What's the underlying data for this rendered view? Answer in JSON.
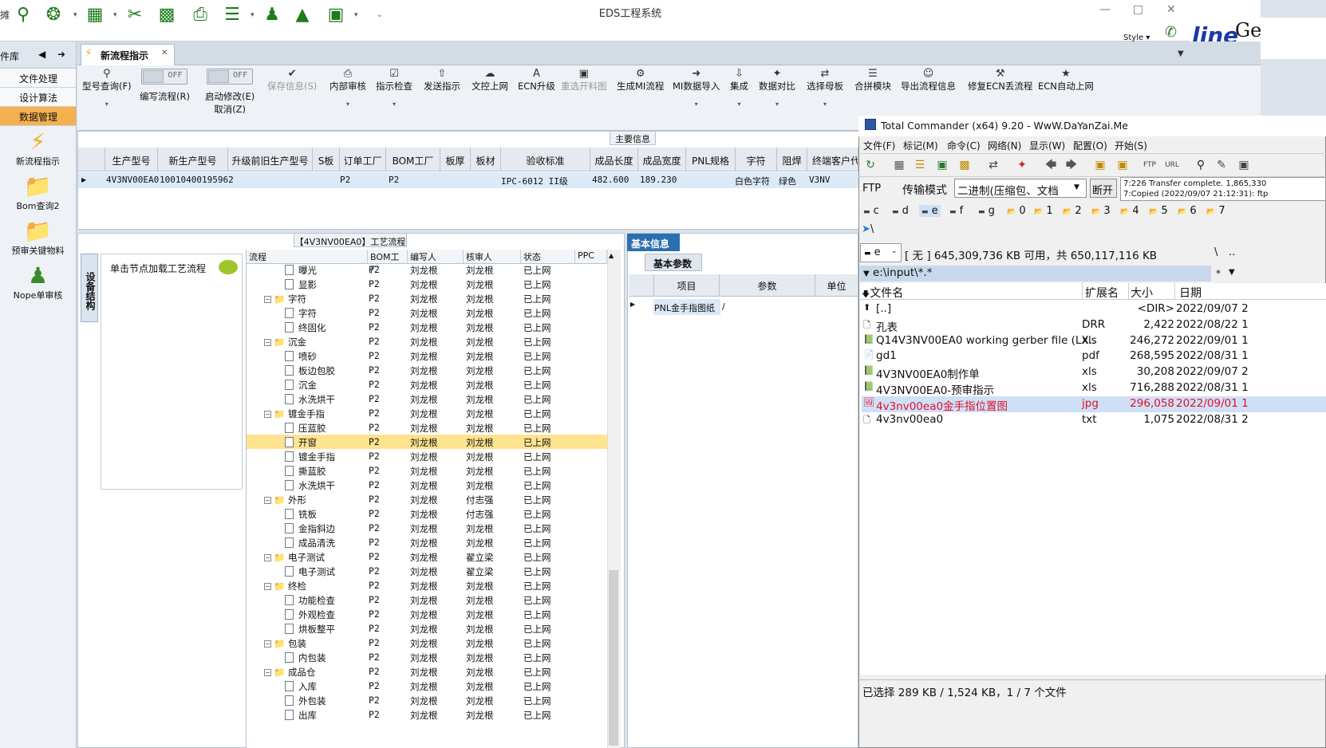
{
  "app": {
    "title": "EDS工程系统",
    "style_label": "Style"
  },
  "quick_toolbar": {
    "icons": [
      "search-icon",
      "network-icon",
      "table-icon",
      "tools-icon",
      "film-icon",
      "clipboard-icon",
      "list-icon",
      "user-icon",
      "chart-icon",
      "monitor-icon"
    ]
  },
  "left_nav": {
    "header": "件库",
    "items": [
      "文件处理",
      "设计算法",
      "数据管理"
    ],
    "icon_items": [
      "新流程指示",
      "Bom查询2",
      "预审关键物料",
      "Nope单审核"
    ]
  },
  "tabs": {
    "active": "新流程指示"
  },
  "ribbon": {
    "query": "型号查询(F)",
    "toggle_off": "OFF",
    "write_flow": "编写流程(R)",
    "start_modify": "启动修改(E)",
    "cancel": "取消(Z)",
    "save_info": "保存信息(S)",
    "internal_review": "内部审核",
    "check": "指示检查",
    "send": "发送指示",
    "upload": "文控上网",
    "ecn_upgrade": "ECN升级",
    "redo_cut": "重选开料图",
    "gen_mi": "生成MI流程",
    "mi_import": "MI数据导入",
    "integrate": "集成",
    "compare": "数据对比",
    "select_mother": "选择母板",
    "merge": "合拼模块",
    "export_flow": "导出流程信息",
    "fix_ecn": "修复ECN丢流程",
    "ecn_auto": "ECN自动上网"
  },
  "main_info": {
    "caption": "主要信息",
    "columns": [
      "生产型号",
      "新生产型号",
      "升级前旧生产型号",
      "S板",
      "订单工厂",
      "BOM工厂",
      "板厚",
      "板材",
      "验收标准",
      "成品长度",
      "成品宽度",
      "PNL规格",
      "字符",
      "阻焊",
      "终端客户代"
    ],
    "row": [
      "4V3NV00EA0",
      "10010400195962",
      "",
      "",
      "P2",
      "P2",
      "",
      "",
      "IPC-6012 II级",
      "482.600",
      "189.230",
      "",
      "白色字符",
      "绿色",
      "V3NV"
    ]
  },
  "process": {
    "caption": "【4V3NV00EA0】工艺流程",
    "side_tab": "设备结构",
    "hint": "单击节点加载工艺流程",
    "columns": [
      "流程",
      "BOM工厂",
      "编写人",
      "核审人",
      "状态",
      "PPC"
    ],
    "rows": [
      {
        "name": "曝光",
        "lvl": 1,
        "f": "P2",
        "w": "刘龙根",
        "r": "刘龙根",
        "s": "已上网"
      },
      {
        "name": "显影",
        "lvl": 1,
        "f": "P2",
        "w": "刘龙根",
        "r": "刘龙根",
        "s": "已上网"
      },
      {
        "name": "字符",
        "lvl": 0,
        "f": "P2",
        "w": "刘龙根",
        "r": "刘龙根",
        "s": "已上网"
      },
      {
        "name": "字符",
        "lvl": 1,
        "f": "P2",
        "w": "刘龙根",
        "r": "刘龙根",
        "s": "已上网"
      },
      {
        "name": "终固化",
        "lvl": 1,
        "f": "P2",
        "w": "刘龙根",
        "r": "刘龙根",
        "s": "已上网"
      },
      {
        "name": "沉金",
        "lvl": 0,
        "f": "P2",
        "w": "刘龙根",
        "r": "刘龙根",
        "s": "已上网"
      },
      {
        "name": "喷砂",
        "lvl": 1,
        "f": "P2",
        "w": "刘龙根",
        "r": "刘龙根",
        "s": "已上网"
      },
      {
        "name": "板边包胶",
        "lvl": 1,
        "f": "P2",
        "w": "刘龙根",
        "r": "刘龙根",
        "s": "已上网"
      },
      {
        "name": "沉金",
        "lvl": 1,
        "f": "P2",
        "w": "刘龙根",
        "r": "刘龙根",
        "s": "已上网"
      },
      {
        "name": "水洗烘干",
        "lvl": 1,
        "f": "P2",
        "w": "刘龙根",
        "r": "刘龙根",
        "s": "已上网"
      },
      {
        "name": "镀金手指",
        "lvl": 0,
        "f": "P2",
        "w": "刘龙根",
        "r": "刘龙根",
        "s": "已上网"
      },
      {
        "name": "压蓝胶",
        "lvl": 1,
        "f": "P2",
        "w": "刘龙根",
        "r": "刘龙根",
        "s": "已上网"
      },
      {
        "name": "开窗",
        "lvl": 1,
        "f": "P2",
        "w": "刘龙根",
        "r": "刘龙根",
        "s": "已上网",
        "sel": true
      },
      {
        "name": "镀金手指",
        "lvl": 1,
        "f": "P2",
        "w": "刘龙根",
        "r": "刘龙根",
        "s": "已上网"
      },
      {
        "name": "撕蓝胶",
        "lvl": 1,
        "f": "P2",
        "w": "刘龙根",
        "r": "刘龙根",
        "s": "已上网"
      },
      {
        "name": "水洗烘干",
        "lvl": 1,
        "f": "P2",
        "w": "刘龙根",
        "r": "刘龙根",
        "s": "已上网"
      },
      {
        "name": "外形",
        "lvl": 0,
        "f": "P2",
        "w": "刘龙根",
        "r": "付志强",
        "s": "已上网"
      },
      {
        "name": "铣板",
        "lvl": 1,
        "f": "P2",
        "w": "刘龙根",
        "r": "付志强",
        "s": "已上网"
      },
      {
        "name": "金指斜边",
        "lvl": 1,
        "f": "P2",
        "w": "刘龙根",
        "r": "刘龙根",
        "s": "已上网"
      },
      {
        "name": "成品清洗",
        "lvl": 1,
        "f": "P2",
        "w": "刘龙根",
        "r": "刘龙根",
        "s": "已上网"
      },
      {
        "name": "电子测试",
        "lvl": 0,
        "f": "P2",
        "w": "刘龙根",
        "r": "翟立梁",
        "s": "已上网"
      },
      {
        "name": "电子测试",
        "lvl": 1,
        "f": "P2",
        "w": "刘龙根",
        "r": "翟立梁",
        "s": "已上网"
      },
      {
        "name": "终检",
        "lvl": 0,
        "f": "P2",
        "w": "刘龙根",
        "r": "刘龙根",
        "s": "已上网"
      },
      {
        "name": "功能检查",
        "lvl": 1,
        "f": "P2",
        "w": "刘龙根",
        "r": "刘龙根",
        "s": "已上网"
      },
      {
        "name": "外观检查",
        "lvl": 1,
        "f": "P2",
        "w": "刘龙根",
        "r": "刘龙根",
        "s": "已上网"
      },
      {
        "name": "烘板整平",
        "lvl": 1,
        "f": "P2",
        "w": "刘龙根",
        "r": "刘龙根",
        "s": "已上网"
      },
      {
        "name": "包装",
        "lvl": 0,
        "f": "P2",
        "w": "刘龙根",
        "r": "刘龙根",
        "s": "已上网"
      },
      {
        "name": "内包装",
        "lvl": 1,
        "f": "P2",
        "w": "刘龙根",
        "r": "刘龙根",
        "s": "已上网"
      },
      {
        "name": "成品仓",
        "lvl": 0,
        "f": "P2",
        "w": "刘龙根",
        "r": "刘龙根",
        "s": "已上网"
      },
      {
        "name": "入库",
        "lvl": 1,
        "f": "P2",
        "w": "刘龙根",
        "r": "刘龙根",
        "s": "已上网"
      },
      {
        "name": "外包装",
        "lvl": 1,
        "f": "P2",
        "w": "刘龙根",
        "r": "刘龙根",
        "s": "已上网"
      },
      {
        "name": "出库",
        "lvl": 1,
        "f": "P2",
        "w": "刘龙根",
        "r": "刘龙根",
        "s": "已上网"
      }
    ]
  },
  "basic_info": {
    "caption": "基本信息",
    "tab": "基本参数",
    "columns": [
      "项目",
      "参数",
      "单位"
    ],
    "row": [
      "PNL金手指图纸",
      "/",
      ""
    ]
  },
  "tc": {
    "title": "Total Commander (x64) 9.20 - WwW.DaYanZai.Me",
    "menu": [
      "文件(F)",
      "标记(M)",
      "命令(C)",
      "网络(N)",
      "显示(W)",
      "配置(O)",
      "开始(S)"
    ],
    "ftp_label": "FTP",
    "mode_label": "传输模式",
    "mode_value": "二进制(压缩包、文档",
    "disconnect": "断开",
    "log1": "7:226 Transfer complete. 1,865,330",
    "log2": "7:Copied (2022/09/07 21:12:31): ftp",
    "drives": [
      "c",
      "d",
      "e",
      "f",
      "g",
      "0",
      "1",
      "2",
      "3",
      "4",
      "5",
      "6",
      "7"
    ],
    "root": "\\",
    "drive_sel": "e",
    "drive_info": "[ 无 ]  645,309,736 KB 可用，共 650,117,116 KB",
    "backslash": "\\",
    "dots": "..",
    "path": "e:\\input\\*.*",
    "star": "*",
    "cols": [
      "文件名",
      "扩展名",
      "大小",
      "日期"
    ],
    "files": [
      {
        "n": "[..]",
        "e": "",
        "s": "<DIR>",
        "d": "2022/09/07 2"
      },
      {
        "n": "孔表",
        "e": "DRR",
        "s": "2,422",
        "d": "2022/08/22 1"
      },
      {
        "n": "Q14V3NV00EA0 working gerber file (LX..",
        "e": "xls",
        "s": "246,272",
        "d": "2022/09/01 1"
      },
      {
        "n": "gd1",
        "e": "pdf",
        "s": "268,595",
        "d": "2022/08/31 1"
      },
      {
        "n": "4V3NV00EA0制作单",
        "e": "xls",
        "s": "30,208",
        "d": "2022/09/07 2"
      },
      {
        "n": "4V3NV00EA0-预审指示",
        "e": "xls",
        "s": "716,288",
        "d": "2022/08/31 1"
      },
      {
        "n": "4v3nv00ea0金手指位置图",
        "e": "jpg",
        "s": "296,058",
        "d": "2022/09/01 1",
        "sel": true
      },
      {
        "n": "4v3nv00ea0",
        "e": "txt",
        "s": "1,075",
        "d": "2022/08/31 2"
      }
    ],
    "status": "已选择 289 KB / 1,524 KB，1 / 7 个文件"
  },
  "banner": {
    "text": "line",
    "text2": "Ge"
  }
}
